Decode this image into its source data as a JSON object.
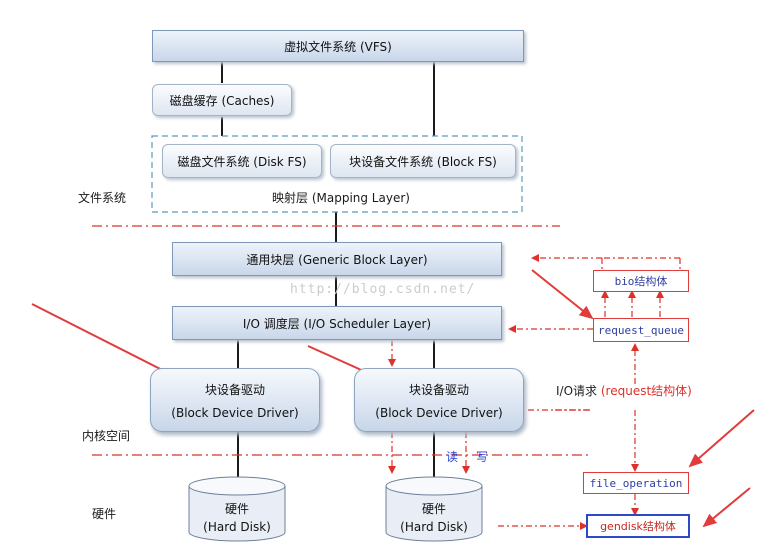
{
  "layers": {
    "vfs": "虚拟文件系统 (VFS)",
    "caches": "磁盘缓存 (Caches)",
    "disk_fs": "磁盘文件系统 (Disk FS)",
    "block_fs": "块设备文件系统 (Block FS)",
    "mapping": "映射层 (Mapping Layer)",
    "generic_block": "通用块层 (Generic Block Layer)",
    "io_scheduler": "I/O 调度层 (I/O Scheduler Layer)"
  },
  "drivers": [
    {
      "line1": "块设备驱动",
      "line2": "(Block Device Driver)"
    },
    {
      "line1": "块设备驱动",
      "line2": "(Block Device Driver)"
    }
  ],
  "disks": [
    {
      "line1": "硬件",
      "line2": "(Hard Disk)"
    },
    {
      "line1": "硬件",
      "line2": "(Hard Disk)"
    }
  ],
  "side_labels": {
    "filesystem": "文件系统",
    "kernel": "内核空间",
    "hardware": "硬件"
  },
  "structs": {
    "bio": "bio结构体",
    "request_queue": "request_queue",
    "file_operation": "file_operation",
    "gendisk": "gendisk结构体"
  },
  "io_request": {
    "prefix": "I/O请求",
    "highlight": "(request结构体)"
  },
  "rw": {
    "read": "读",
    "write": "写"
  },
  "watermark": "http://blog.csdn.net/",
  "colors": {
    "dashed_red": "#e0302a",
    "line": "#1a1a1a",
    "arrow_red": "#e23b3b",
    "blue_border": "#2d49c8"
  }
}
